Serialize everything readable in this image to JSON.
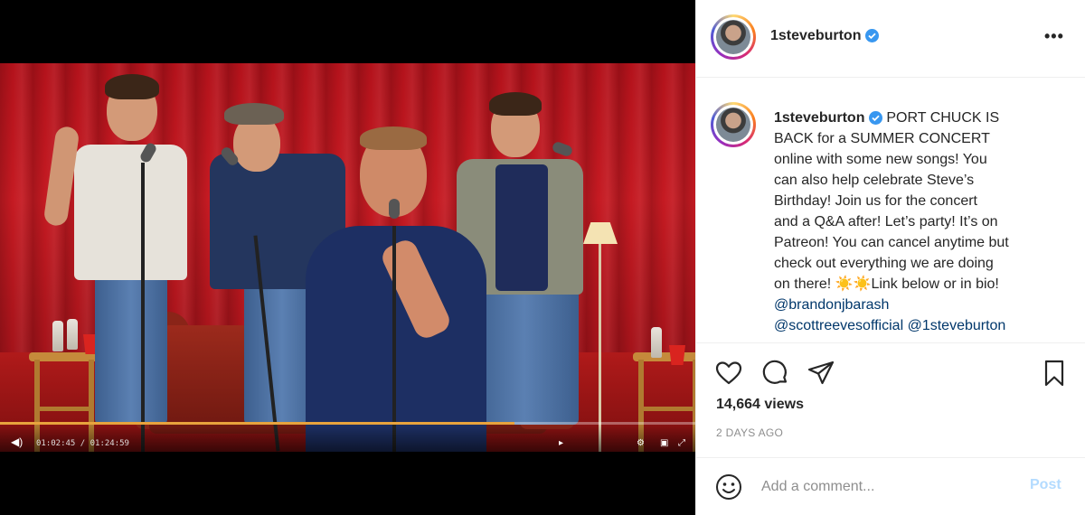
{
  "post": {
    "username": "1steveburton",
    "caption_lines": [
      "PORT CHUCK IS",
      "BACK for a SUMMER CONCERT",
      "online with some new songs! You",
      "can also help celebrate Steve’s",
      "Birthday! Join us for the concert",
      "and a Q&A after! Let’s party! It’s on",
      "Patreon! You can cancel anytime but",
      "check out everything we are doing",
      "on there! ☀️☀️Link below or in bio!"
    ],
    "mentions": [
      "@brandonjbarash",
      "@scottreevesofficial",
      "@1steveburton"
    ],
    "views": "14,664 views",
    "posted_ago": "2 DAYS AGO"
  },
  "video": {
    "time_display": "01:02:45 / 01:24:59",
    "progress": 0.74
  },
  "comment": {
    "placeholder": "Add a comment...",
    "post_label": "Post"
  },
  "colors": {
    "verified": "#3897f0",
    "mention": "#00376b",
    "post_disabled": "#b3dbff",
    "muted_text": "#8e8e8e",
    "progress": "#e8a33d"
  },
  "icons": {
    "more": "more-horizontal-icon",
    "like": "heart-icon",
    "comment": "comment-bubble-icon",
    "share": "paper-plane-icon",
    "save": "bookmark-icon",
    "mute": "speaker-muted-icon",
    "emoji": "smiley-icon"
  }
}
